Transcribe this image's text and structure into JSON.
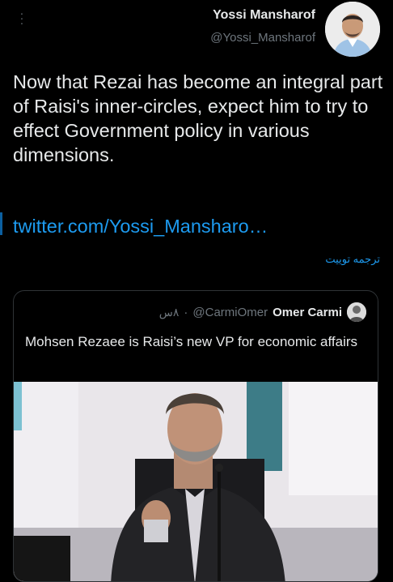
{
  "author": {
    "name": "Yossi Mansharof",
    "handle": "@Yossi_Mansharof"
  },
  "tweet": {
    "text": "Now that Rezai has become an integral part of Raisi's inner-circles, expect him to try to effect Government policy in various dimensions.",
    "link": "twitter.com/Yossi_Mansharo…",
    "translate_label": "ترجمه توییت"
  },
  "quoted": {
    "name": "Omer Carmi",
    "handle": "@CarmiOmer",
    "separator": "·",
    "time": "۸س",
    "text": "Mohsen Rezaee is Raisi’s new VP for economic affairs"
  },
  "icons": {
    "more": "more-vertical-icon"
  },
  "colors": {
    "background": "#000000",
    "text": "#e7e9ea",
    "secondary": "#6e767d",
    "link": "#1d9bf0",
    "border": "#2f3336"
  }
}
